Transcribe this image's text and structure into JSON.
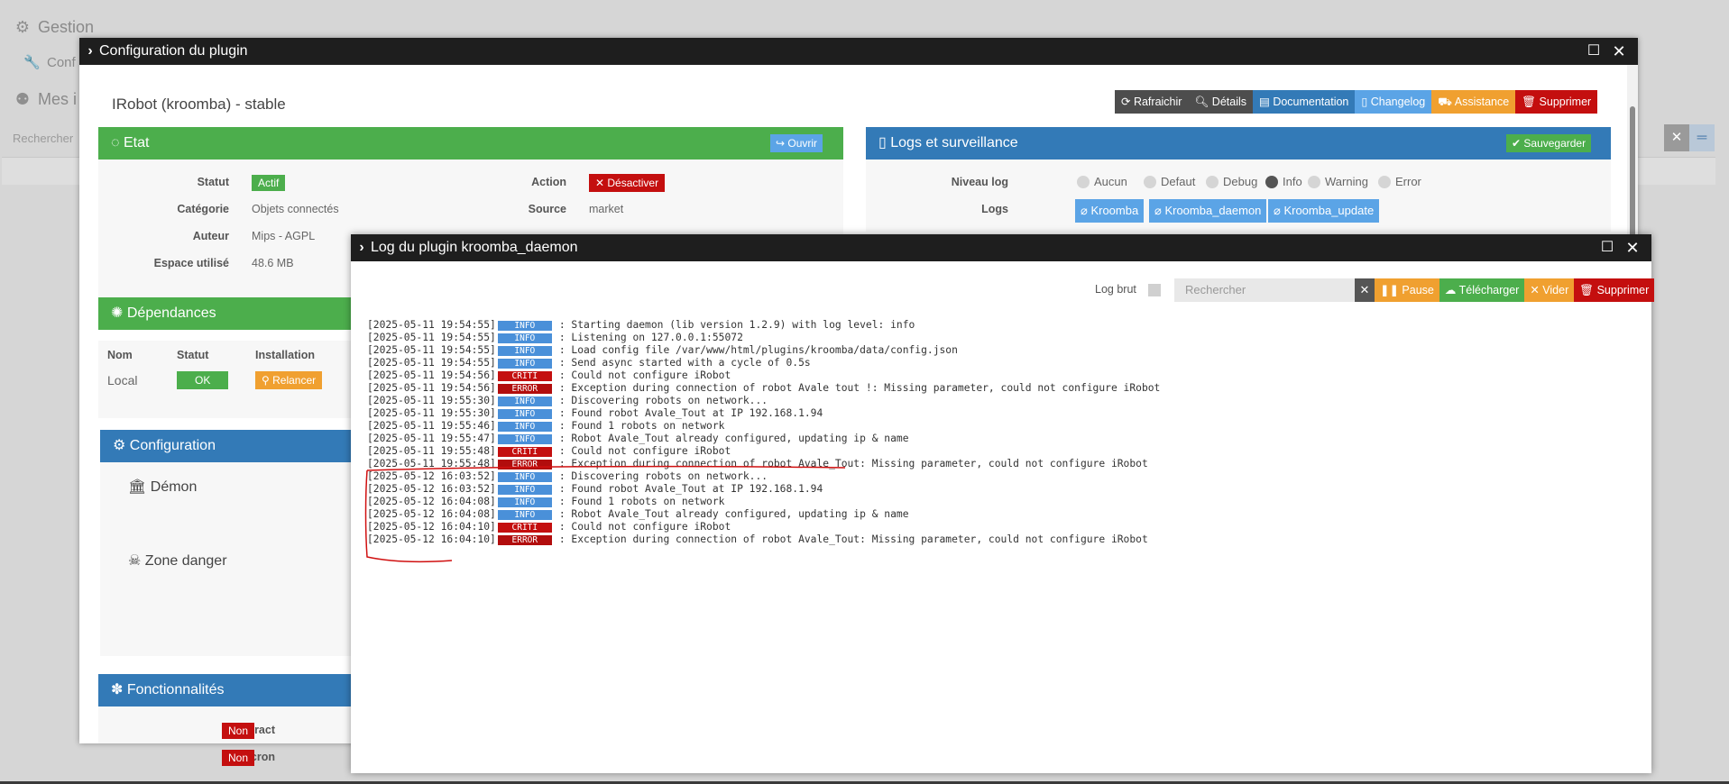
{
  "background": {
    "menu": [
      {
        "label": "Gestion",
        "icon": "gear-icon"
      },
      {
        "label": "Conf",
        "icon": "wrench-icon"
      },
      {
        "label": "Mes i",
        "icon": "robot-icon"
      }
    ],
    "search_placeholder": "Rechercher"
  },
  "config_dialog": {
    "title": "Configuration du plugin",
    "plugin_title": "IRobot (kroomba) - stable",
    "actions": [
      "Rafraichir",
      "Détails",
      "Documentation",
      "Changelog",
      "Assistance",
      "Supprimer"
    ],
    "etat": {
      "title": "Etat",
      "open_label": "Ouvrir",
      "statut_label": "Statut",
      "statut_value": "Actif",
      "categorie_label": "Catégorie",
      "categorie_value": "Objets connectés",
      "auteur_label": "Auteur",
      "auteur_value": "Mips - AGPL",
      "espace_label": "Espace utilisé",
      "espace_value": "48.6 MB",
      "action_label": "Action",
      "action_value": "Désactiver",
      "source_label": "Source",
      "source_value": "market"
    },
    "dependances": {
      "title": "Dépendances",
      "headers": [
        "Nom",
        "Statut",
        "Installation"
      ],
      "row": {
        "nom": "Local",
        "statut": "OK",
        "installation": "Relancer"
      }
    },
    "configuration": {
      "title": "Configuration",
      "demon": "Démon",
      "zone_danger": "Zone danger"
    },
    "fonctionnalites": {
      "title": "Fonctionnalités",
      "items": [
        {
          "label": "interact",
          "value": "Non"
        },
        {
          "label": "cron",
          "value": "Non"
        }
      ]
    },
    "logs": {
      "title": "Logs et surveillance",
      "save_label": "Sauvegarder",
      "niveau_label": "Niveau log",
      "levels": [
        "Aucun",
        "Defaut",
        "Debug",
        "Info",
        "Warning",
        "Error"
      ],
      "selected_level": "Info",
      "logs_label": "Logs",
      "log_buttons": [
        "Kroomba",
        "Kroomba_daemon",
        "Kroomba_update"
      ]
    }
  },
  "log_dialog": {
    "title": "Log du plugin kroomba_daemon",
    "log_brut_label": "Log brut",
    "search_placeholder": "Rechercher",
    "buttons": [
      "Pause",
      "Télécharger",
      "Vider",
      "Supprimer"
    ],
    "lines": [
      {
        "ts": "[2025-05-11 19:54:55]",
        "level": "INFO",
        "msg": ": Starting daemon (lib version 1.2.9) with log level: info"
      },
      {
        "ts": "[2025-05-11 19:54:55]",
        "level": "INFO",
        "msg": ": Listening on 127.0.0.1:55072"
      },
      {
        "ts": "[2025-05-11 19:54:55]",
        "level": "INFO",
        "msg": ": Load config file /var/www/html/plugins/kroomba/data/config.json"
      },
      {
        "ts": "[2025-05-11 19:54:55]",
        "level": "INFO",
        "msg": ": Send async started with a cycle of 0.5s"
      },
      {
        "ts": "[2025-05-11 19:54:56]",
        "level": "CRITI",
        "msg": ": Could not configure iRobot"
      },
      {
        "ts": "[2025-05-11 19:54:56]",
        "level": "ERROR",
        "msg": ": Exception during connection of robot Avale tout !: Missing parameter, could not configure iRobot"
      },
      {
        "ts": "[2025-05-11 19:55:30]",
        "level": "INFO",
        "msg": ": Discovering robots on network..."
      },
      {
        "ts": "[2025-05-11 19:55:30]",
        "level": "INFO",
        "msg": ": Found robot Avale_Tout at IP 192.168.1.94"
      },
      {
        "ts": "[2025-05-11 19:55:46]",
        "level": "INFO",
        "msg": ": Found 1 robots on network"
      },
      {
        "ts": "[2025-05-11 19:55:47]",
        "level": "INFO",
        "msg": ": Robot Avale_Tout already configured, updating ip & name"
      },
      {
        "ts": "[2025-05-11 19:55:48]",
        "level": "CRITI",
        "msg": ": Could not configure iRobot"
      },
      {
        "ts": "[2025-05-11 19:55:48]",
        "level": "ERROR",
        "msg": ": Exception during connection of robot Avale_Tout: Missing parameter, could not configure iRobot"
      },
      {
        "ts": "[2025-05-12 16:03:52]",
        "level": "INFO",
        "msg": ": Discovering robots on network..."
      },
      {
        "ts": "[2025-05-12 16:03:52]",
        "level": "INFO",
        "msg": ": Found robot Avale_Tout at IP 192.168.1.94"
      },
      {
        "ts": "[2025-05-12 16:04:08]",
        "level": "INFO",
        "msg": ": Found 1 robots on network"
      },
      {
        "ts": "[2025-05-12 16:04:08]",
        "level": "INFO",
        "msg": ": Robot Avale_Tout already configured, updating ip & name"
      },
      {
        "ts": "[2025-05-12 16:04:10]",
        "level": "CRITI",
        "msg": ": Could not configure iRobot"
      },
      {
        "ts": "[2025-05-12 16:04:10]",
        "level": "ERROR",
        "msg": ": Exception during connection of robot Avale_Tout: Missing parameter, could not configure iRobot"
      }
    ]
  }
}
